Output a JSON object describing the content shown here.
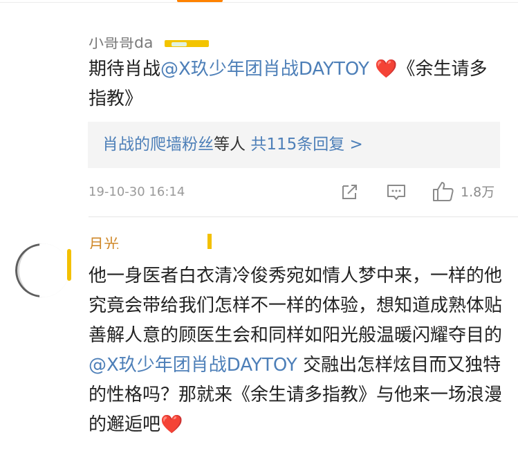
{
  "top": {
    "partial_name": "小哥哥da"
  },
  "comment1": {
    "text_a": "期待肖战",
    "mention": "@X玖少年团肖战DAYTOY",
    "heart": "❤️",
    "text_b": "《余生请多指教》",
    "reply_summary": {
      "fan_name": "肖战的爬墙粉丝",
      "and_others": "等人",
      "total_replies": "共115条回复 >"
    },
    "timestamp": "19-10-30 16:14",
    "likes": "1.8万"
  },
  "comment2": {
    "partial_name": "月光",
    "text_a": "他一身医者白衣清冷俊秀宛如情人梦中来，一样的他究竟会带给我们怎样不一样的体验，想知道成熟体贴善解人意的顾医生会和同样如阳光般温暖闪耀夺目的",
    "mention": "@X玖少年团肖战DAYTOY",
    "text_b": " 交融出怎样炫目而又独特的性格吗？那就来《余生请多指教》与他来一场浪漫的邂逅吧",
    "heart": "❤️"
  },
  "colors": {
    "accent": "#ff8200",
    "link": "#4d7fb8",
    "heart": "#ff1f2d"
  },
  "icons": [
    "share-icon",
    "comment-icon",
    "like-icon"
  ]
}
